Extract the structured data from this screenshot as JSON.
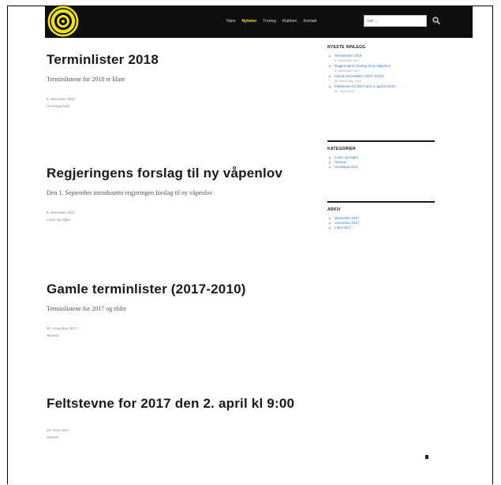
{
  "nav": {
    "items": [
      "Hjem",
      "Nyheter",
      "Trening",
      "Klubben",
      "Kontakt"
    ],
    "active_index": 1
  },
  "search": {
    "placeholder": "Søk ..."
  },
  "posts": [
    {
      "title": "Terminlister 2018",
      "excerpt": "Terminlistene for 2018 er klare",
      "date": "8. desember 2017",
      "category": "Uncategorized"
    },
    {
      "title": "Regjeringens forslag til ny våpenlov",
      "excerpt": "Den 1. September introduserte regjeringen forslag til ny våpenlov",
      "date": "6. desember 2017",
      "category": "Lover og regler"
    },
    {
      "title": "Gamle terminlister (2017-2010)",
      "excerpt": "Terminlistene for 2017 og eldre",
      "date": "30. november 2017",
      "category": "Stevner"
    },
    {
      "title": "Feltstevne for 2017 den 2. april kl 9:00",
      "excerpt": "",
      "date": "30. mars 2017",
      "category": "Stevner"
    }
  ],
  "sidebar": {
    "recent": {
      "heading": "NYESTE INNLEGG",
      "items": [
        {
          "title": "Terminlister 2018",
          "date": "8. desember 2017"
        },
        {
          "title": "Regjeringens forslag til ny våpenlov",
          "date": "6. desember 2017"
        },
        {
          "title": "Gamle terminlister (2017-2010)",
          "date": "30. november 2017"
        },
        {
          "title": "Feltstevne for 2017 den 2. april kl 9:00",
          "date": "30. mars 2017"
        }
      ]
    },
    "categories": {
      "heading": "KATEGORIER",
      "items": [
        "Lover og regler",
        "Stevner",
        "Uncategorized"
      ]
    },
    "archive": {
      "heading": "ARKIV",
      "items": [
        "desember 2017",
        "november 2017",
        "mars 2017"
      ]
    }
  },
  "colors": {
    "header_bg": "#0f0f0f",
    "accent": "#f2e400",
    "link": "#3a7bbf"
  }
}
